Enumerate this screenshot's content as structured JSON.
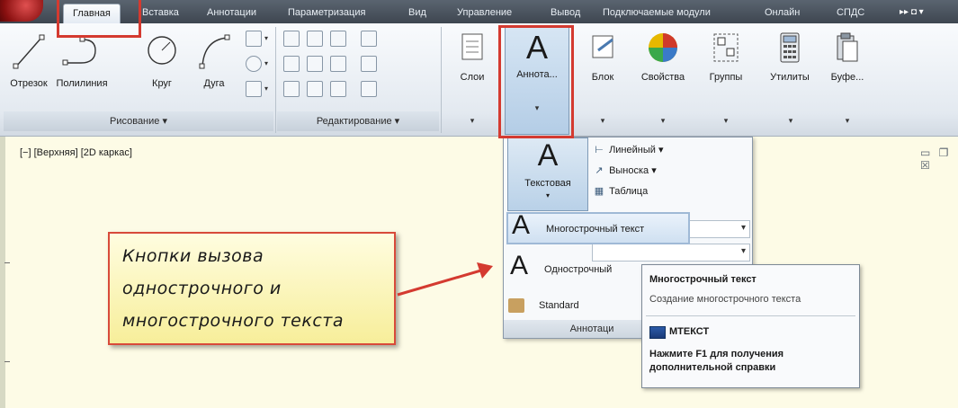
{
  "tabs": [
    "Главная",
    "Вставка",
    "Аннотации",
    "Параметризация",
    "Вид",
    "Управление",
    "Вывод",
    "Подключаемые модули",
    "Онлайн",
    "СПДС"
  ],
  "tab_extra": "▸▸ ◘ ▾",
  "ribbon": {
    "draw_tools": [
      "Отрезок",
      "Полилиния",
      "Круг",
      "Дуга"
    ],
    "draw_panel": "Рисование ▾",
    "modify_panel": "Редактирование ▾",
    "buttons": [
      "Слои",
      "Аннота...",
      "Блок",
      "Свойства",
      "Группы",
      "Утилиты",
      "Буфе..."
    ],
    "arrow": "▾"
  },
  "viewport": {
    "label": "[−] [Верхняя] [2D каркас]",
    "controls": "▭ ❐ ☒"
  },
  "dropdown": {
    "text_button": "Текстовая",
    "big_letter": "A",
    "linear": "Линейный ▾",
    "leader": "Выноска ▾",
    "table": "Таблица",
    "mtext": "Многострочный текст",
    "stext": "Однострочный",
    "style": "Standard",
    "footer": "Аннотаци"
  },
  "tooltip": {
    "title": "Многострочный текст",
    "desc": "Создание многострочного текста",
    "command": "МТЕКСТ",
    "help": "Нажмите F1 для получения дополнительной справки"
  },
  "callout": {
    "lines": [
      "Кнопки вызова",
      "однострочного и",
      "многострочного текста"
    ]
  },
  "colors": {
    "highlight": "#d43a30",
    "arrow": "#d43a30",
    "callout_bg": "#f7ee9a"
  }
}
